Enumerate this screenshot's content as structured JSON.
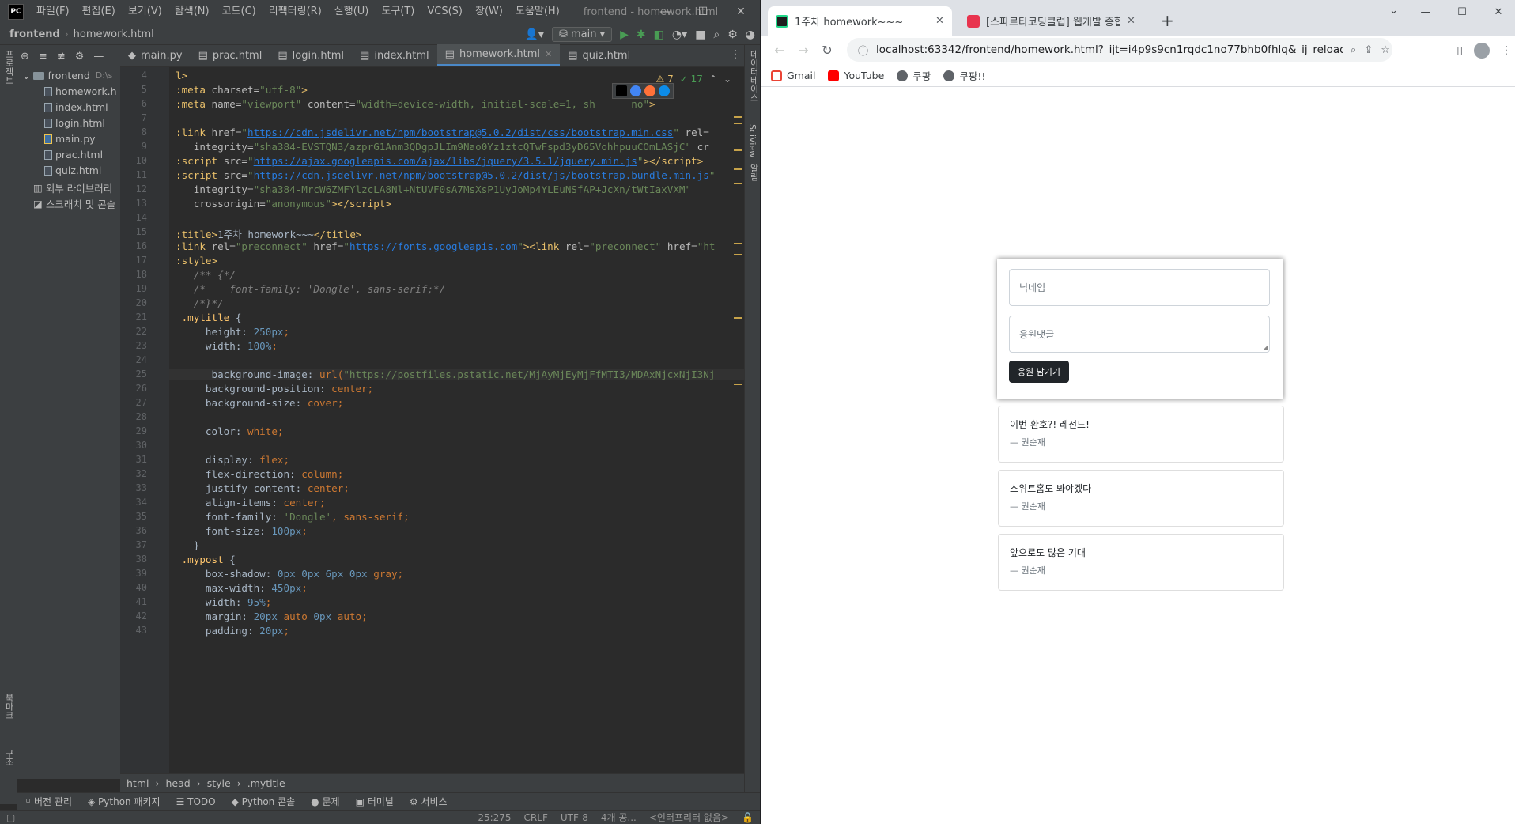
{
  "ide": {
    "logo": "PC",
    "menu": [
      "파일(F)",
      "편집(E)",
      "보기(V)",
      "탐색(N)",
      "코드(C)",
      "리팩터링(R)",
      "실행(U)",
      "도구(T)",
      "VCS(S)",
      "창(W)",
      "도움말(H)"
    ],
    "title": "frontend - homework.html",
    "breadcrumb": [
      "frontend",
      "homework.html"
    ],
    "branch": "main",
    "project_tree": {
      "root": "frontend",
      "root_path": "D:\\s",
      "files": [
        "homework.h",
        "index.html",
        "login.html",
        "main.py",
        "prac.html",
        "quiz.html"
      ],
      "external_libs": "외부 라이브러리",
      "scratches": "스크래치 및 콘솔"
    },
    "left_vertical_tabs": [
      "프로젝트",
      "북마크",
      "구조"
    ],
    "right_vertical_tabs": [
      "데이터베이스",
      "SciView",
      "알림"
    ],
    "tabs": [
      {
        "label": "main.py",
        "active": false
      },
      {
        "label": "prac.html",
        "active": false
      },
      {
        "label": "login.html",
        "active": false
      },
      {
        "label": "index.html",
        "active": false
      },
      {
        "label": "homework.html",
        "active": true
      },
      {
        "label": "quiz.html",
        "active": false
      }
    ],
    "inspections": {
      "warnings": "7",
      "ok": "17"
    },
    "line_numbers": [
      "4",
      "5",
      "6",
      "7",
      "8",
      "9",
      "10",
      "11",
      "12",
      "13",
      "14",
      "15",
      "16",
      "17",
      "18",
      "19",
      "20",
      "21",
      "22",
      "23",
      "24",
      "25",
      "26",
      "27",
      "28",
      "29",
      "30",
      "31",
      "32",
      "33",
      "34",
      "35",
      "36",
      "37",
      "38",
      "39",
      "40",
      "41",
      "42",
      "43"
    ],
    "code_breadcrumb": [
      "html",
      "head",
      "style",
      ".mytitle"
    ],
    "tool_tabs": [
      "버전 관리",
      "Python 패키지",
      "TODO",
      "Python 콘솔",
      "문제",
      "터미널",
      "서비스"
    ],
    "status": {
      "position": "25:275",
      "line_sep": "CRLF",
      "encoding": "UTF-8",
      "indent": "4개 공...",
      "interpreter": "<인터프리터 없음>"
    },
    "colors": {
      "bg": "#2b2b2b",
      "panel": "#3c3f41",
      "tag": "#e8bf6a",
      "string": "#6a8759",
      "number": "#6897bb",
      "keyword": "#cc7832"
    }
  },
  "browser": {
    "tabs": [
      {
        "title": "1주차 homework~~~",
        "active": true
      },
      {
        "title": "[스파르타코딩클럽] 웹개발 종합",
        "active": false
      }
    ],
    "url": "localhost:63342/frontend/homework.html?_ijt=i4p9s9cn1rqdc1no77bhb0fhlq&_ij_reload=REL...",
    "bookmarks": [
      "Gmail",
      "YouTube",
      "쿠팡",
      "쿠팡!!"
    ],
    "page": {
      "name_placeholder": "닉네임",
      "comment_placeholder": "응원댓글",
      "submit_label": "응원 남기기",
      "cards": [
        {
          "text": "이번 환호?! 레전드!",
          "author": "— 권순재"
        },
        {
          "text": "스위트홈도 봐야겠다",
          "author": "— 권순재"
        },
        {
          "text": "앞으로도 많은 기대",
          "author": "— 권순재"
        }
      ]
    }
  }
}
